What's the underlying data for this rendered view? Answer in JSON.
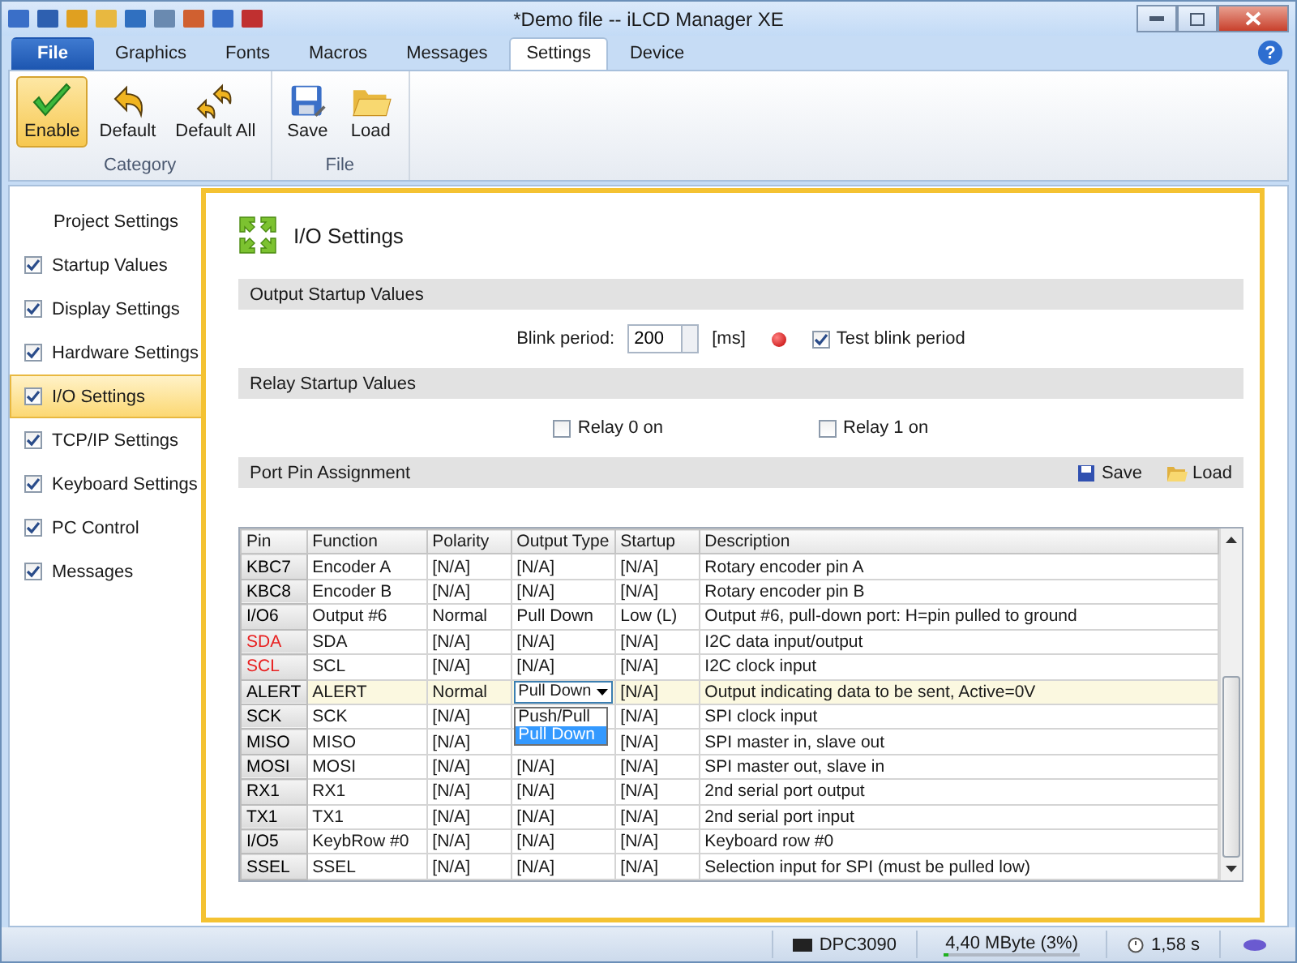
{
  "window": {
    "title": "*Demo file -- iLCD Manager XE"
  },
  "ribbon_tabs": [
    {
      "label": "File",
      "kind": "file",
      "selected": false
    },
    {
      "label": "Graphics",
      "kind": "tab",
      "selected": false
    },
    {
      "label": "Fonts",
      "kind": "tab",
      "selected": false
    },
    {
      "label": "Macros",
      "kind": "tab",
      "selected": false
    },
    {
      "label": "Messages",
      "kind": "tab",
      "selected": false
    },
    {
      "label": "Settings",
      "kind": "tab",
      "selected": true
    },
    {
      "label": "Device",
      "kind": "tab",
      "selected": false
    }
  ],
  "help": "?",
  "ribbon_groups": [
    {
      "label": "Category",
      "buttons": [
        {
          "label": "Enable",
          "selected": true
        },
        {
          "label": "Default",
          "selected": false
        },
        {
          "label": "Default All",
          "selected": false
        }
      ]
    },
    {
      "label": "File",
      "buttons": [
        {
          "label": "Save",
          "selected": false
        },
        {
          "label": "Load",
          "selected": false
        }
      ]
    }
  ],
  "sidebar": {
    "header": "Project Settings",
    "items": [
      {
        "label": "Startup Values",
        "checked": true,
        "selected": false
      },
      {
        "label": "Display Settings",
        "checked": true,
        "selected": false
      },
      {
        "label": "Hardware Settings",
        "checked": true,
        "selected": false
      },
      {
        "label": "I/O Settings",
        "checked": true,
        "selected": true
      },
      {
        "label": "TCP/IP Settings",
        "checked": true,
        "selected": false
      },
      {
        "label": "Keyboard Settings",
        "checked": true,
        "selected": false
      },
      {
        "label": "PC Control",
        "checked": true,
        "selected": false
      },
      {
        "label": "Messages",
        "checked": true,
        "selected": false
      }
    ]
  },
  "page": {
    "title": "I/O Settings"
  },
  "output_startup": {
    "heading": "Output Startup Values",
    "blink_label": "Blink period:",
    "blink_value": "200",
    "unit": "[ms]",
    "test_blink": {
      "label": "Test blink period",
      "checked": true
    }
  },
  "relay_startup": {
    "heading": "Relay Startup Values",
    "relays": [
      {
        "label": "Relay 0 on",
        "checked": false
      },
      {
        "label": "Relay 1 on",
        "checked": false
      }
    ]
  },
  "port_pins": {
    "heading": "Port Pin Assignment",
    "actions": [
      "Save",
      "Load"
    ],
    "columns": [
      "Pin",
      "Function",
      "Polarity",
      "Output Type",
      "Startup",
      "Description"
    ],
    "rows": [
      {
        "pin": "KBC7",
        "color": "#000000",
        "selected": false,
        "function": "Encoder A",
        "polarity": "[N/A]",
        "output_type": "[N/A]",
        "startup": "[N/A]",
        "description": "Rotary encoder pin A"
      },
      {
        "pin": "KBC8",
        "color": "#000000",
        "selected": false,
        "function": "Encoder B",
        "polarity": "[N/A]",
        "output_type": "[N/A]",
        "startup": "[N/A]",
        "description": "Rotary encoder pin B"
      },
      {
        "pin": "I/O6",
        "color": "#000000",
        "selected": false,
        "function": "Output #6",
        "polarity": "Normal",
        "output_type": "Pull Down",
        "startup": "Low (L)",
        "description": "Output #6, pull-down port: H=pin pulled to ground"
      },
      {
        "pin": "SDA",
        "color": "#e82020",
        "selected": false,
        "function": "SDA",
        "polarity": "[N/A]",
        "output_type": "[N/A]",
        "startup": "[N/A]",
        "description": "I2C data input/output"
      },
      {
        "pin": "SCL",
        "color": "#e82020",
        "selected": false,
        "function": "SCL",
        "polarity": "[N/A]",
        "output_type": "[N/A]",
        "startup": "[N/A]",
        "description": "I2C clock input"
      },
      {
        "pin": "ALERT",
        "color": "#000000",
        "selected": true,
        "function": "ALERT",
        "polarity": "Normal",
        "startup": "[N/A]",
        "description": "Output indicating data to be sent, Active=0V",
        "editor": {
          "value": "Pull Down",
          "options": [
            {
              "label": "Push/Pull",
              "selected": false
            },
            {
              "label": "Pull Down",
              "selected": true
            }
          ]
        }
      },
      {
        "pin": "SCK",
        "color": "#000000",
        "selected": false,
        "function": "SCK",
        "polarity": "[N/A]",
        "startup": "[N/A]",
        "description": "SPI clock input"
      },
      {
        "pin": "MISO",
        "color": "#000000",
        "selected": false,
        "function": "MISO",
        "polarity": "[N/A]",
        "startup": "[N/A]",
        "description": "SPI master in, slave out"
      },
      {
        "pin": "MOSI",
        "color": "#000000",
        "selected": false,
        "function": "MOSI",
        "polarity": "[N/A]",
        "output_type": "[N/A]",
        "startup": "[N/A]",
        "description": "SPI master out, slave in"
      },
      {
        "pin": "RX1",
        "color": "#000000",
        "selected": false,
        "function": "RX1",
        "polarity": "[N/A]",
        "output_type": "[N/A]",
        "startup": "[N/A]",
        "description": "2nd serial port output"
      },
      {
        "pin": "TX1",
        "color": "#000000",
        "selected": false,
        "function": "TX1",
        "polarity": "[N/A]",
        "output_type": "[N/A]",
        "startup": "[N/A]",
        "description": "2nd serial port input"
      },
      {
        "pin": "I/O5",
        "color": "#000000",
        "selected": false,
        "function": "KeybRow #0",
        "polarity": "[N/A]",
        "output_type": "[N/A]",
        "startup": "[N/A]",
        "description": "Keyboard row #0"
      },
      {
        "pin": "SSEL",
        "color": "#000000",
        "selected": false,
        "function": "SSEL",
        "polarity": "[N/A]",
        "output_type": "[N/A]",
        "startup": "[N/A]",
        "description": "Selection input for SPI (must be pulled low)"
      }
    ]
  },
  "status_bar": {
    "device": "DPC3090",
    "memory": "4,40 MByte (3%)",
    "level": 0.03,
    "time": "1,58 s"
  }
}
